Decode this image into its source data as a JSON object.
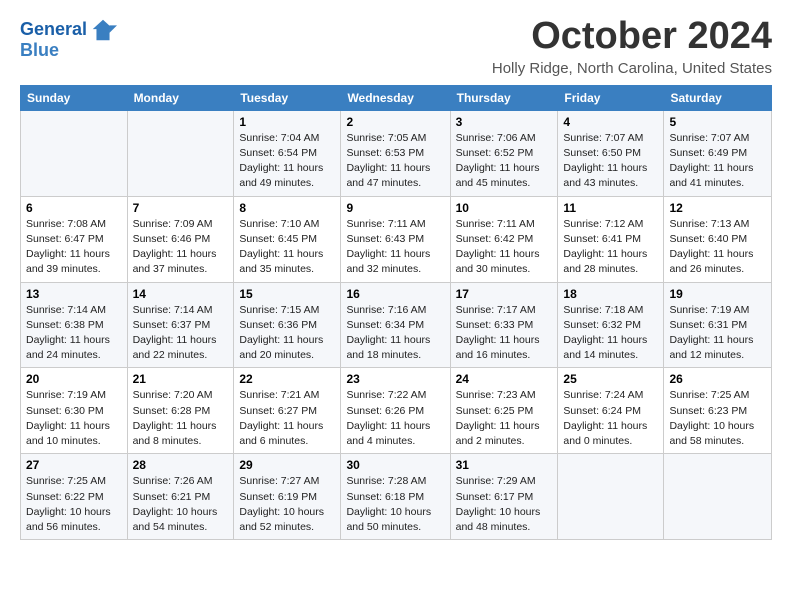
{
  "header": {
    "logo_line1": "General",
    "logo_line2": "Blue",
    "month": "October 2024",
    "location": "Holly Ridge, North Carolina, United States"
  },
  "weekdays": [
    "Sunday",
    "Monday",
    "Tuesday",
    "Wednesday",
    "Thursday",
    "Friday",
    "Saturday"
  ],
  "weeks": [
    [
      {
        "day": "",
        "info": ""
      },
      {
        "day": "",
        "info": ""
      },
      {
        "day": "1",
        "info": "Sunrise: 7:04 AM\nSunset: 6:54 PM\nDaylight: 11 hours and 49 minutes."
      },
      {
        "day": "2",
        "info": "Sunrise: 7:05 AM\nSunset: 6:53 PM\nDaylight: 11 hours and 47 minutes."
      },
      {
        "day": "3",
        "info": "Sunrise: 7:06 AM\nSunset: 6:52 PM\nDaylight: 11 hours and 45 minutes."
      },
      {
        "day": "4",
        "info": "Sunrise: 7:07 AM\nSunset: 6:50 PM\nDaylight: 11 hours and 43 minutes."
      },
      {
        "day": "5",
        "info": "Sunrise: 7:07 AM\nSunset: 6:49 PM\nDaylight: 11 hours and 41 minutes."
      }
    ],
    [
      {
        "day": "6",
        "info": "Sunrise: 7:08 AM\nSunset: 6:47 PM\nDaylight: 11 hours and 39 minutes."
      },
      {
        "day": "7",
        "info": "Sunrise: 7:09 AM\nSunset: 6:46 PM\nDaylight: 11 hours and 37 minutes."
      },
      {
        "day": "8",
        "info": "Sunrise: 7:10 AM\nSunset: 6:45 PM\nDaylight: 11 hours and 35 minutes."
      },
      {
        "day": "9",
        "info": "Sunrise: 7:11 AM\nSunset: 6:43 PM\nDaylight: 11 hours and 32 minutes."
      },
      {
        "day": "10",
        "info": "Sunrise: 7:11 AM\nSunset: 6:42 PM\nDaylight: 11 hours and 30 minutes."
      },
      {
        "day": "11",
        "info": "Sunrise: 7:12 AM\nSunset: 6:41 PM\nDaylight: 11 hours and 28 minutes."
      },
      {
        "day": "12",
        "info": "Sunrise: 7:13 AM\nSunset: 6:40 PM\nDaylight: 11 hours and 26 minutes."
      }
    ],
    [
      {
        "day": "13",
        "info": "Sunrise: 7:14 AM\nSunset: 6:38 PM\nDaylight: 11 hours and 24 minutes."
      },
      {
        "day": "14",
        "info": "Sunrise: 7:14 AM\nSunset: 6:37 PM\nDaylight: 11 hours and 22 minutes."
      },
      {
        "day": "15",
        "info": "Sunrise: 7:15 AM\nSunset: 6:36 PM\nDaylight: 11 hours and 20 minutes."
      },
      {
        "day": "16",
        "info": "Sunrise: 7:16 AM\nSunset: 6:34 PM\nDaylight: 11 hours and 18 minutes."
      },
      {
        "day": "17",
        "info": "Sunrise: 7:17 AM\nSunset: 6:33 PM\nDaylight: 11 hours and 16 minutes."
      },
      {
        "day": "18",
        "info": "Sunrise: 7:18 AM\nSunset: 6:32 PM\nDaylight: 11 hours and 14 minutes."
      },
      {
        "day": "19",
        "info": "Sunrise: 7:19 AM\nSunset: 6:31 PM\nDaylight: 11 hours and 12 minutes."
      }
    ],
    [
      {
        "day": "20",
        "info": "Sunrise: 7:19 AM\nSunset: 6:30 PM\nDaylight: 11 hours and 10 minutes."
      },
      {
        "day": "21",
        "info": "Sunrise: 7:20 AM\nSunset: 6:28 PM\nDaylight: 11 hours and 8 minutes."
      },
      {
        "day": "22",
        "info": "Sunrise: 7:21 AM\nSunset: 6:27 PM\nDaylight: 11 hours and 6 minutes."
      },
      {
        "day": "23",
        "info": "Sunrise: 7:22 AM\nSunset: 6:26 PM\nDaylight: 11 hours and 4 minutes."
      },
      {
        "day": "24",
        "info": "Sunrise: 7:23 AM\nSunset: 6:25 PM\nDaylight: 11 hours and 2 minutes."
      },
      {
        "day": "25",
        "info": "Sunrise: 7:24 AM\nSunset: 6:24 PM\nDaylight: 11 hours and 0 minutes."
      },
      {
        "day": "26",
        "info": "Sunrise: 7:25 AM\nSunset: 6:23 PM\nDaylight: 10 hours and 58 minutes."
      }
    ],
    [
      {
        "day": "27",
        "info": "Sunrise: 7:25 AM\nSunset: 6:22 PM\nDaylight: 10 hours and 56 minutes."
      },
      {
        "day": "28",
        "info": "Sunrise: 7:26 AM\nSunset: 6:21 PM\nDaylight: 10 hours and 54 minutes."
      },
      {
        "day": "29",
        "info": "Sunrise: 7:27 AM\nSunset: 6:19 PM\nDaylight: 10 hours and 52 minutes."
      },
      {
        "day": "30",
        "info": "Sunrise: 7:28 AM\nSunset: 6:18 PM\nDaylight: 10 hours and 50 minutes."
      },
      {
        "day": "31",
        "info": "Sunrise: 7:29 AM\nSunset: 6:17 PM\nDaylight: 10 hours and 48 minutes."
      },
      {
        "day": "",
        "info": ""
      },
      {
        "day": "",
        "info": ""
      }
    ]
  ]
}
